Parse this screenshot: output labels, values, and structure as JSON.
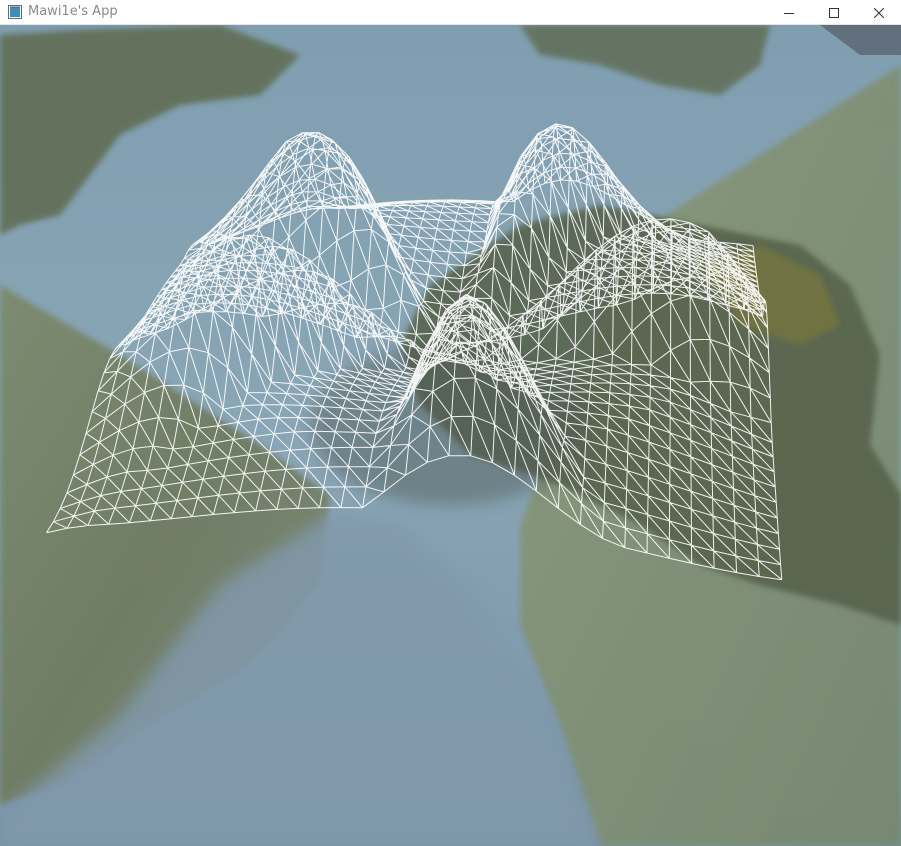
{
  "window": {
    "title": "Mawi1e's App",
    "icons": {
      "app": "app-window-icon",
      "minimize": "minimize-icon",
      "maximize": "maximize-icon",
      "close": "close-icon"
    }
  },
  "viewport": {
    "description_colors": {
      "water": "#7f9eb3",
      "grass": "#6f7f60",
      "wireframe": "#ffffff"
    }
  }
}
